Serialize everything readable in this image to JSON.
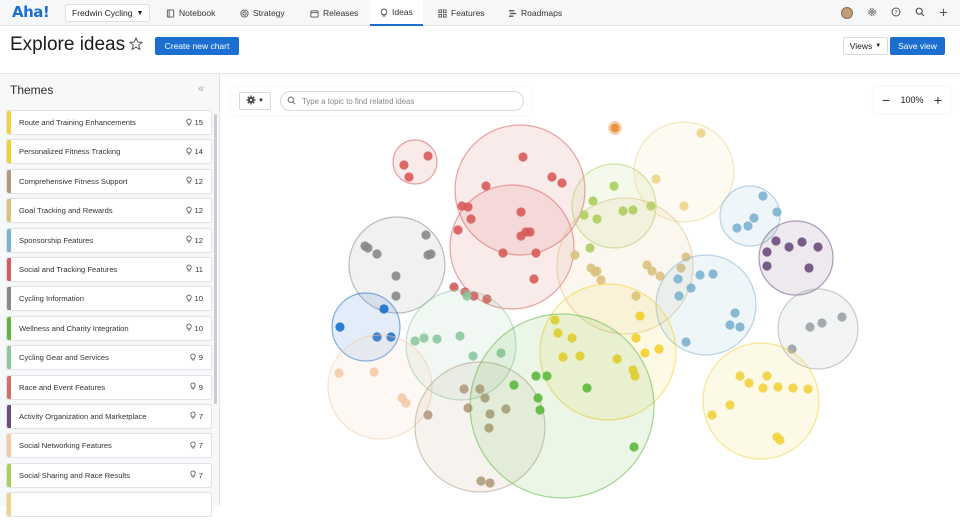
{
  "nav": {
    "logo": "Aha!",
    "workspace": "Fredwin Cycling",
    "tabs": [
      {
        "label": "Notebook",
        "icon": "book-icon"
      },
      {
        "label": "Strategy",
        "icon": "target-icon"
      },
      {
        "label": "Releases",
        "icon": "calendar-icon"
      },
      {
        "label": "Ideas",
        "icon": "lightbulb-icon"
      },
      {
        "label": "Features",
        "icon": "grid-icon"
      },
      {
        "label": "Roadmaps",
        "icon": "roadmap-icon"
      }
    ],
    "active_tab": "Ideas"
  },
  "header": {
    "title": "Explore ideas",
    "create_button": "Create new chart",
    "views_button": "Views",
    "save_button": "Save view"
  },
  "sidebar": {
    "title": "Themes",
    "themes": [
      {
        "label": "Route and Training Enhancements",
        "count": "15",
        "color": "#f2d13c"
      },
      {
        "label": "Personalized Fitness Tracking",
        "count": "14",
        "color": "#f2cf2a"
      },
      {
        "label": "Comprehensive Fitness Support",
        "count": "12",
        "color": "#b39a7d"
      },
      {
        "label": "Goal Tracking and Rewards",
        "count": "12",
        "color": "#dcc07e"
      },
      {
        "label": "Sponsorship Features",
        "count": "12",
        "color": "#7cb2cf"
      },
      {
        "label": "Social and Tracking Features",
        "count": "11",
        "color": "#d85a5a"
      },
      {
        "label": "Cycling Information",
        "count": "10",
        "color": "#888888"
      },
      {
        "label": "Wellness and Charity Integration",
        "count": "10",
        "color": "#5cb83a"
      },
      {
        "label": "Cycling Gear and Services",
        "count": "9",
        "color": "#8cc7a0"
      },
      {
        "label": "Race and Event Features",
        "count": "9",
        "color": "#d76a62"
      },
      {
        "label": "Activity Organization and Marketplace",
        "count": "7",
        "color": "#6a4d7c"
      },
      {
        "label": "Social Networking Features",
        "count": "7",
        "color": "#f3c9a5"
      },
      {
        "label": "Social Sharing and Race Results",
        "count": "7",
        "color": "#a8cf5a"
      },
      {
        "label": "",
        "count": "",
        "color": "#f0d38a"
      }
    ]
  },
  "canvas": {
    "search_placeholder": "Type a topic to find related ideas",
    "zoom_level": "100%"
  },
  "colors": {
    "accent": "#1a6fd0"
  }
}
